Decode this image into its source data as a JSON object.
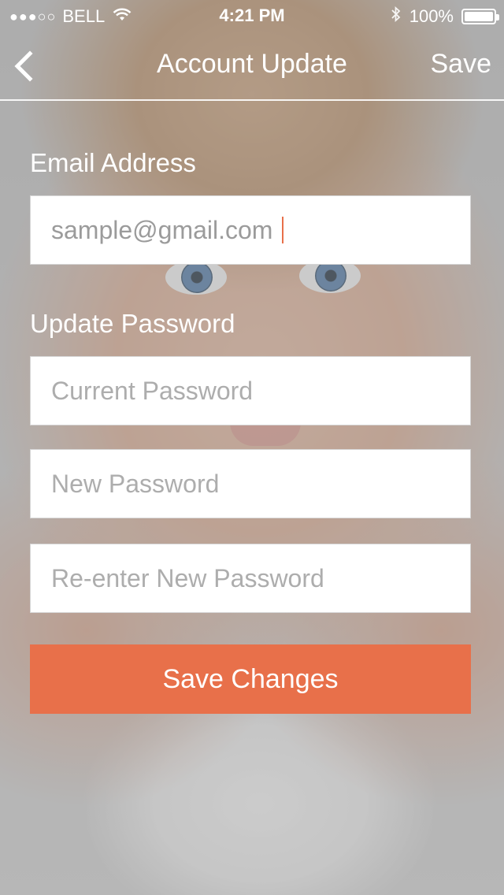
{
  "status_bar": {
    "signal_dots": "●●●○○",
    "carrier": "BELL",
    "time": "4:21 PM",
    "battery_percent": "100%",
    "wifi_icon": "wifi-icon",
    "bluetooth_icon": "bluetooth-icon"
  },
  "nav": {
    "back_icon": "chevron-left-icon",
    "title": "Account Update",
    "save_label": "Save"
  },
  "form": {
    "email_label": "Email Address",
    "email_value": "sample@gmail.com",
    "password_section_label": "Update Password",
    "current_password_placeholder": "Current Password",
    "new_password_placeholder": "New Password",
    "reenter_password_placeholder": "Re-enter New Password",
    "submit_label": "Save Changes"
  },
  "colors": {
    "accent": "#e8704a",
    "text_on_dark": "#ffffff",
    "placeholder": "#adadad"
  }
}
